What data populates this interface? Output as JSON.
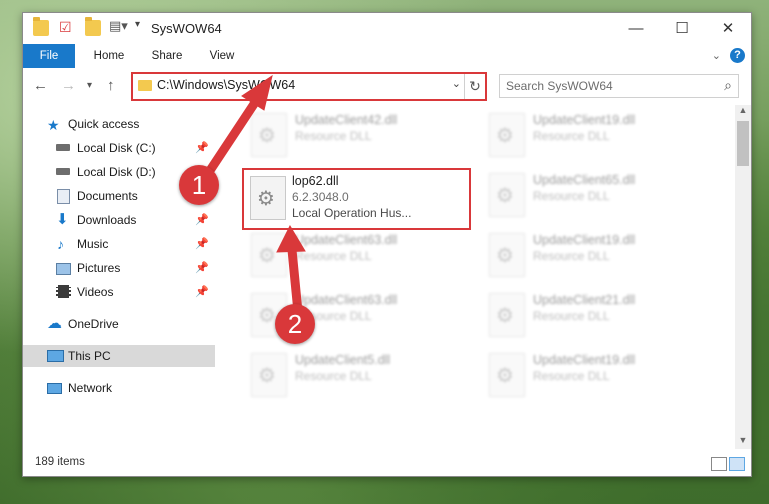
{
  "window": {
    "title": "SysWOW64",
    "controls": {
      "minimize": "—",
      "maximize": "☐",
      "close": "✕"
    }
  },
  "ribbon": {
    "tabs": [
      "File",
      "Home",
      "Share",
      "View"
    ],
    "expand_icon": "chevron-down-icon",
    "help_icon": "help-icon"
  },
  "address": {
    "path": "C:\\Windows\\SysWOW64",
    "search_placeholder": "Search SysWOW64"
  },
  "sidebar": {
    "items": [
      {
        "label": "Quick access",
        "icon": "star-icon",
        "pinned": false
      },
      {
        "label": "Local Disk (C:)",
        "icon": "drive-icon",
        "pinned": true
      },
      {
        "label": "Local Disk (D:)",
        "icon": "drive-icon",
        "pinned": false
      },
      {
        "label": "Documents",
        "icon": "documents-icon",
        "pinned": true
      },
      {
        "label": "Downloads",
        "icon": "download-icon",
        "pinned": true
      },
      {
        "label": "Music",
        "icon": "music-icon",
        "pinned": true
      },
      {
        "label": "Pictures",
        "icon": "pictures-icon",
        "pinned": true
      },
      {
        "label": "Videos",
        "icon": "videos-icon",
        "pinned": true
      },
      {
        "label": "OneDrive",
        "icon": "cloud-icon",
        "pinned": false
      },
      {
        "label": "This PC",
        "icon": "computer-icon",
        "pinned": false,
        "selected": true
      },
      {
        "label": "Network",
        "icon": "network-icon",
        "pinned": false
      }
    ]
  },
  "files": {
    "highlighted": {
      "name": "lop62.dll",
      "version": "6.2.3048.0",
      "description": "Local Operation Hus..."
    },
    "background": [
      {
        "name": "UpdateClient42.dll",
        "type": "Resource DLL"
      },
      {
        "name": "UpdateClient19.dll",
        "type": "Resource DLL"
      },
      {
        "name": "UpdateClient65.dll",
        "type": "Resource DLL"
      },
      {
        "name": "UpdateClient63.dll",
        "type": "Resource DLL"
      },
      {
        "name": "UpdateClient19.dll",
        "type": "Resource DLL"
      },
      {
        "name": "UpdateClient63.dll",
        "type": "Resource DLL"
      },
      {
        "name": "UpdateClient21.dll",
        "type": "Resource DLL"
      },
      {
        "name": "UpdateClient5.dll",
        "type": "Resource DLL"
      },
      {
        "name": "UpdateClient19.dll",
        "type": "Resource DLL"
      }
    ]
  },
  "status": {
    "item_count": "189 items"
  },
  "annotations": {
    "step1": "1",
    "step2": "2",
    "color": "#d9383a"
  }
}
